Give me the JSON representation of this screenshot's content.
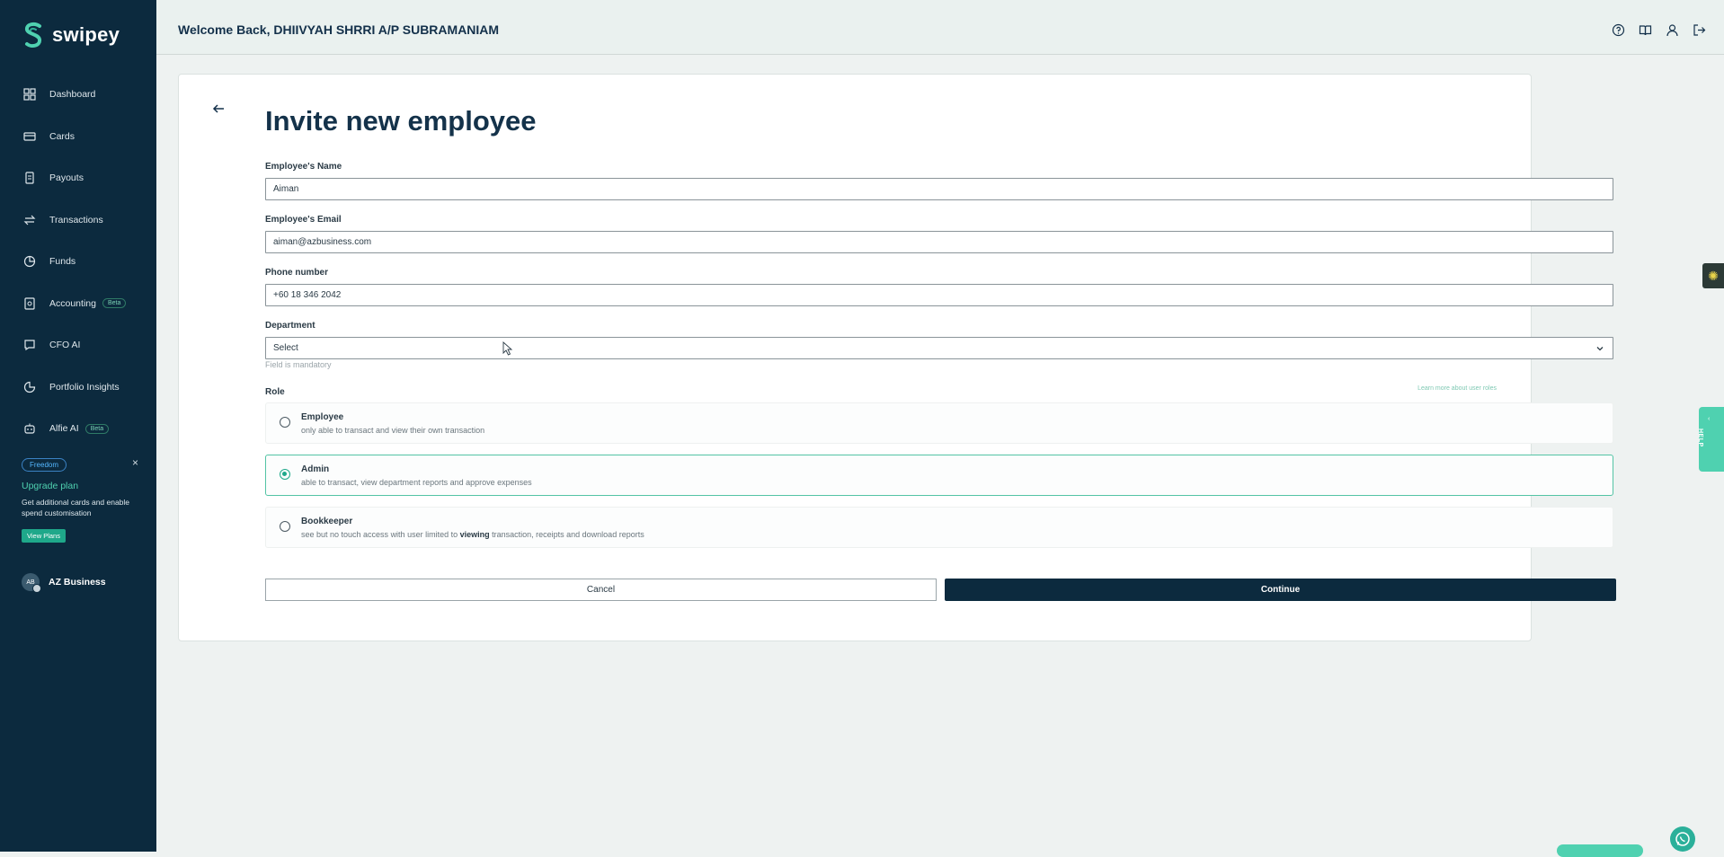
{
  "app": {
    "brand": "swipey"
  },
  "sidebar": {
    "items": [
      {
        "label": "Dashboard",
        "icon": "dashboard-icon"
      },
      {
        "label": "Cards",
        "icon": "card-icon"
      },
      {
        "label": "Payouts",
        "icon": "payouts-icon"
      },
      {
        "label": "Transactions",
        "icon": "transactions-icon"
      },
      {
        "label": "Funds",
        "icon": "funds-icon"
      },
      {
        "label": "Accounting",
        "icon": "accounting-icon",
        "badge": "Beta"
      },
      {
        "label": "CFO AI",
        "icon": "chat-icon"
      },
      {
        "label": "Portfolio Insights",
        "icon": "pie-chart-icon"
      },
      {
        "label": "Alfie AI",
        "icon": "robot-icon",
        "badge": "Beta"
      }
    ],
    "promo": {
      "plan_badge": "Freedom",
      "close": "×",
      "upgrade": "Upgrade plan",
      "description": "Get additional cards and enable spend customisation",
      "cta": "View Plans"
    },
    "account": {
      "initials": "AB",
      "name": "AZ Business"
    }
  },
  "header": {
    "welcome": "Welcome Back, DHIIVYAH SHRRI A/P SUBRAMANIAM"
  },
  "form": {
    "title": "Invite new employee",
    "name": {
      "label": "Employee's Name",
      "value": "Aiman"
    },
    "email": {
      "label": "Employee's Email",
      "value": "aiman@azbusiness.com"
    },
    "phone": {
      "label": "Phone number",
      "value": "+60 18 346 2042"
    },
    "department": {
      "label": "Department",
      "placeholder": "Select",
      "hint": "Field is mandatory"
    },
    "role": {
      "label": "Role",
      "learn_more": "Learn more about user roles",
      "options": [
        {
          "title": "Employee",
          "description": "only able to transact and view their own transaction",
          "selected": false
        },
        {
          "title": "Admin",
          "description": "able to transact, view department reports and approve expenses",
          "selected": true
        },
        {
          "title": "Bookkeeper",
          "description_pre": "see but no touch access with user limited to ",
          "description_bold": "viewing",
          "description_post": " transaction, receipts and download reports",
          "selected": false
        }
      ]
    },
    "cancel": "Cancel",
    "continue": "Continue"
  },
  "widgets": {
    "help": "HELP",
    "help_chevron": "‹"
  },
  "colors": {
    "sidebar": "#0c2a3e",
    "accent": "#1fa88a",
    "primary_button": "#0c2a3e"
  }
}
